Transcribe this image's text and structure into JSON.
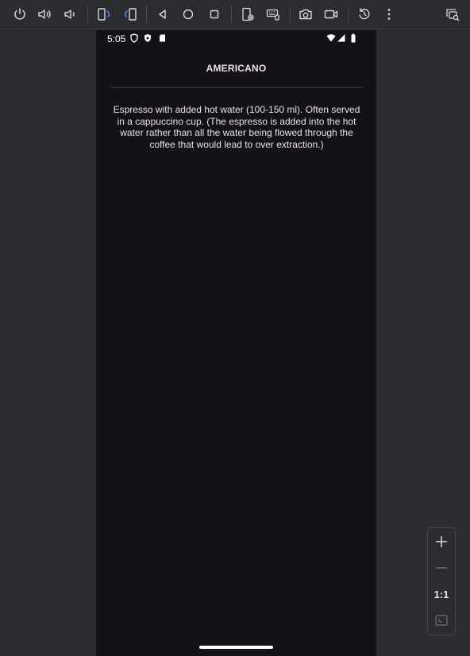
{
  "toolbar": {
    "icons": [
      "power-icon",
      "volume-up-icon",
      "volume-down-icon",
      "rotate-left-icon",
      "rotate-right-icon",
      "back-icon",
      "home-icon",
      "overview-icon",
      "device-settings-icon",
      "keyboard-icon",
      "camera-icon",
      "video-icon",
      "reset-icon",
      "more-icon",
      "device-mirror-icon"
    ]
  },
  "statusbar": {
    "time": "5:05"
  },
  "app": {
    "title": "AMERICANO",
    "description": "Espresso with added hot water (100-150 ml). Often served in a cappuccino cup. (The espresso is added into the hot water rather than all the water being flowed through the coffee that would lead to over extraction.)"
  },
  "zoom": {
    "zoom_in": "+",
    "zoom_out": "—",
    "actual_size": "1:1"
  },
  "colors": {
    "frame_bg": "#2b2c30",
    "screen_bg": "#141218",
    "text": "#e6e1e5",
    "accent_blue": "#5b8ff9"
  }
}
